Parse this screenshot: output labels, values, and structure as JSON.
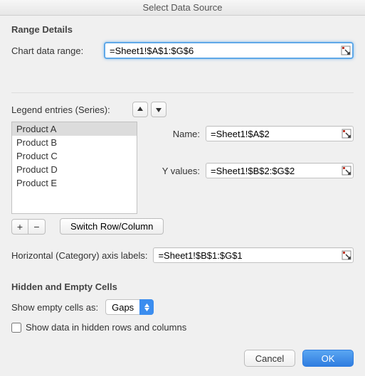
{
  "window": {
    "title": "Select Data Source"
  },
  "section1": {
    "title": "Range Details",
    "chart_range_label": "Chart data range:",
    "chart_range_value": "=Sheet1!$A$1:$G$6"
  },
  "legend": {
    "heading": "Legend entries (Series):",
    "items": [
      {
        "label": "Product A"
      },
      {
        "label": "Product B"
      },
      {
        "label": "Product C"
      },
      {
        "label": "Product D"
      },
      {
        "label": "Product E"
      }
    ],
    "selected_index": 0,
    "name_label": "Name:",
    "name_value": "=Sheet1!$A$2",
    "yvalues_label": "Y values:",
    "yvalues_value": "=Sheet1!$B$2:$G$2",
    "switch_label": "Switch Row/Column",
    "plus": "+",
    "minus": "−"
  },
  "haxis": {
    "label": "Horizontal (Category) axis labels:",
    "value": "=Sheet1!$B$1:$G$1"
  },
  "section2": {
    "title": "Hidden and Empty Cells",
    "empty_label": "Show empty cells as:",
    "empty_value": "Gaps",
    "show_hidden_label": "Show data in hidden rows and columns",
    "show_hidden_checked": false
  },
  "buttons": {
    "cancel": "Cancel",
    "ok": "OK"
  }
}
